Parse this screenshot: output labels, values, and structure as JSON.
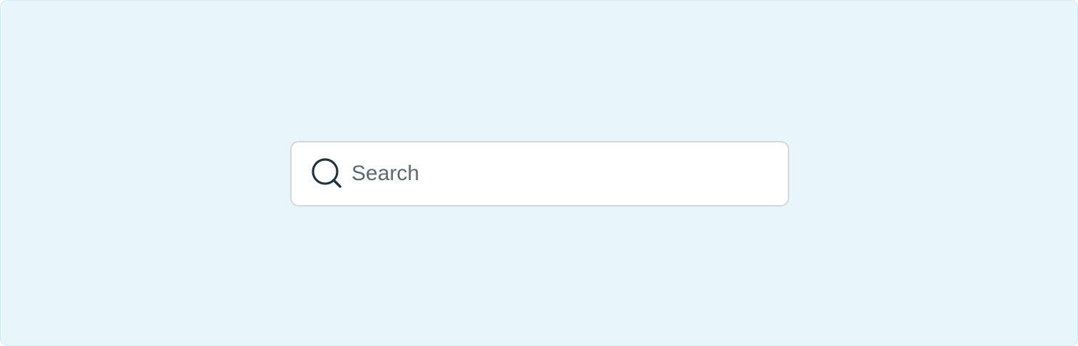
{
  "search": {
    "placeholder": "Search",
    "value": "",
    "icon": "search-icon"
  },
  "colors": {
    "page_background": "#e8f5fa",
    "box_background": "#ffffff",
    "box_border": "#d1d8dc",
    "icon": "#1e3440",
    "placeholder_text": "#5a6a72"
  }
}
